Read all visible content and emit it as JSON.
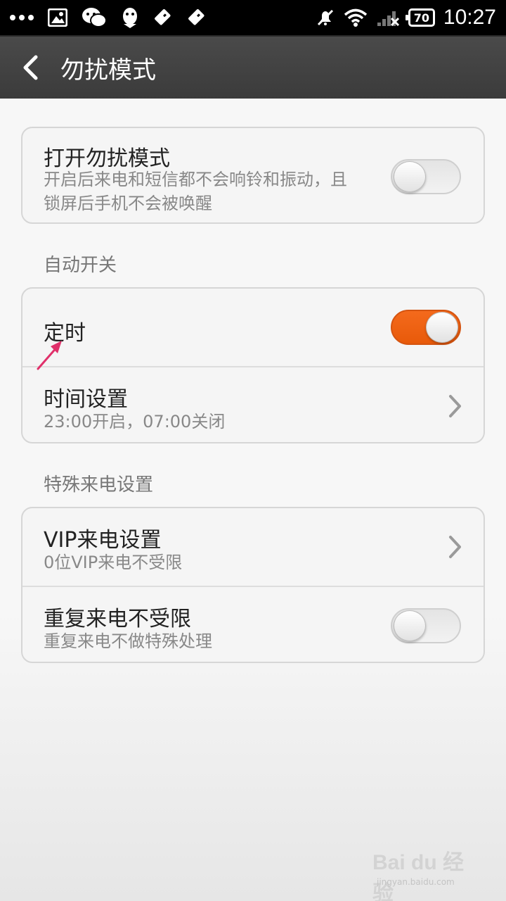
{
  "status_bar": {
    "battery": "70",
    "time": "10:27"
  },
  "header": {
    "title": "勿扰模式"
  },
  "dnd_card": {
    "title": "打开勿扰模式",
    "description_line1": "开启后来电和短信都不会响铃和振动，且",
    "description_line2": "锁屏后手机不会被唤醒",
    "enabled": false
  },
  "auto_section": {
    "label": "自动开关",
    "timer": {
      "title": "定时",
      "enabled": true
    },
    "time_settings": {
      "title": "时间设置",
      "summary": "23:00开启，07:00关闭"
    }
  },
  "special_section": {
    "label": "特殊来电设置",
    "vip": {
      "title": "VIP来电设置",
      "summary": "0位VIP来电不受限"
    },
    "repeat": {
      "title": "重复来电不受限",
      "summary": "重复来电不做特殊处理",
      "enabled": false
    }
  },
  "watermark": {
    "text": "Bai du 经验",
    "url": "jingyan.baidu.com"
  },
  "colors": {
    "accent": "#f26a1b",
    "annotation_arrow": "#e0306a"
  },
  "icons": [
    "more-dots-icon",
    "gallery-icon",
    "wechat-icon",
    "qq-icon",
    "usb-icon",
    "usb-debug-icon",
    "mute-icon",
    "wifi-icon",
    "signal-icon",
    "battery-icon",
    "back-chevron-icon",
    "chevron-right-icon"
  ]
}
